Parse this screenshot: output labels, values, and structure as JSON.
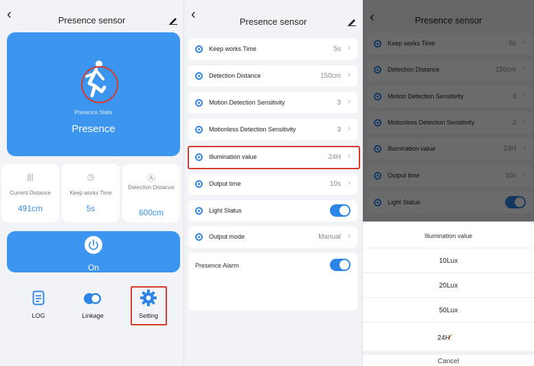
{
  "header": {
    "title": "Presence sensor"
  },
  "hero": {
    "state_label": "Presence State",
    "state_value": "Presence"
  },
  "stats": [
    {
      "label": "Current Distance",
      "value": "491cm"
    },
    {
      "label": "Keep works Time",
      "value": "5s"
    },
    {
      "label": "Detection Distance",
      "value": "600cm"
    }
  ],
  "power": {
    "label": "On"
  },
  "functions": [
    {
      "label": "LOG"
    },
    {
      "label": "Linkage"
    },
    {
      "label": "Setting"
    }
  ],
  "settings": [
    {
      "label": "Keep works Time",
      "value": "5s"
    },
    {
      "label": "Detection Distance",
      "value": "150cm"
    },
    {
      "label": "Motion Detection Sensitivity",
      "value": "3"
    },
    {
      "label": "Motionless Detection Sensitivity",
      "value": "3"
    },
    {
      "label": "Illumination value",
      "value": "24H"
    },
    {
      "label": "Output time",
      "value": "10s"
    },
    {
      "label": "Light Status",
      "toggle": true
    },
    {
      "label": "Output mode",
      "value": "Manual"
    }
  ],
  "alarm": {
    "label": "Presence Alarm",
    "toggle": true
  },
  "picker": {
    "title": "Illumination value",
    "options": [
      "10Lux",
      "20Lux",
      "50Lux",
      "24H"
    ],
    "selected": "24H",
    "cancel": "Cancel"
  },
  "colors": {
    "accent": "#3c95ef",
    "highlight": "#d8392b",
    "check": "#e0602d"
  }
}
